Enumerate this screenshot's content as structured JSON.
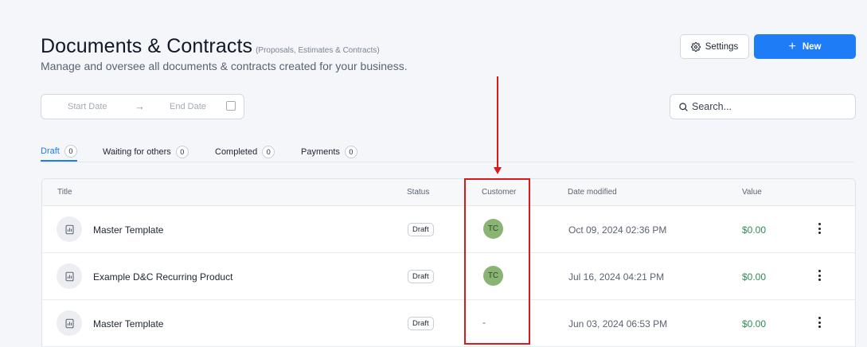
{
  "header": {
    "title": "Documents & Contracts",
    "title_note": "(Proposals, Estimates & Contracts)",
    "subtitle": "Manage and oversee all documents & contracts created for your business."
  },
  "actions": {
    "settings_label": "Settings",
    "new_label": "New",
    "settings_icon": "gear-icon",
    "new_icon": "plus-icon"
  },
  "filters": {
    "start_date_placeholder": "Start Date",
    "end_date_placeholder": "End Date",
    "arrow": "→",
    "search_placeholder": "Search..."
  },
  "tabs": [
    {
      "label": "Draft",
      "count": "0",
      "active": true
    },
    {
      "label": "Waiting for others",
      "count": "0",
      "active": false
    },
    {
      "label": "Completed",
      "count": "0",
      "active": false
    },
    {
      "label": "Payments",
      "count": "0",
      "active": false
    }
  ],
  "table": {
    "columns": [
      "Title",
      "Status",
      "Customer",
      "Date modified",
      "Value"
    ],
    "rows": [
      {
        "title": "Master Template",
        "status": "Draft",
        "customer": "TC",
        "date": "Oct 09, 2024 02:36 PM",
        "value": "$0.00"
      },
      {
        "title": "Example D&C Recurring Product",
        "status": "Draft",
        "customer": "TC",
        "date": "Jul 16, 2024 04:21 PM",
        "value": "$0.00"
      },
      {
        "title": "Master Template",
        "status": "Draft",
        "customer": "-",
        "date": "Jun 03, 2024 06:53 PM",
        "value": "$0.00"
      }
    ]
  },
  "colors": {
    "accent": "#1f7cf7",
    "value_green": "#2e8b57",
    "avatar_green": "#8ab474",
    "annotation_red": "#d9191c"
  }
}
